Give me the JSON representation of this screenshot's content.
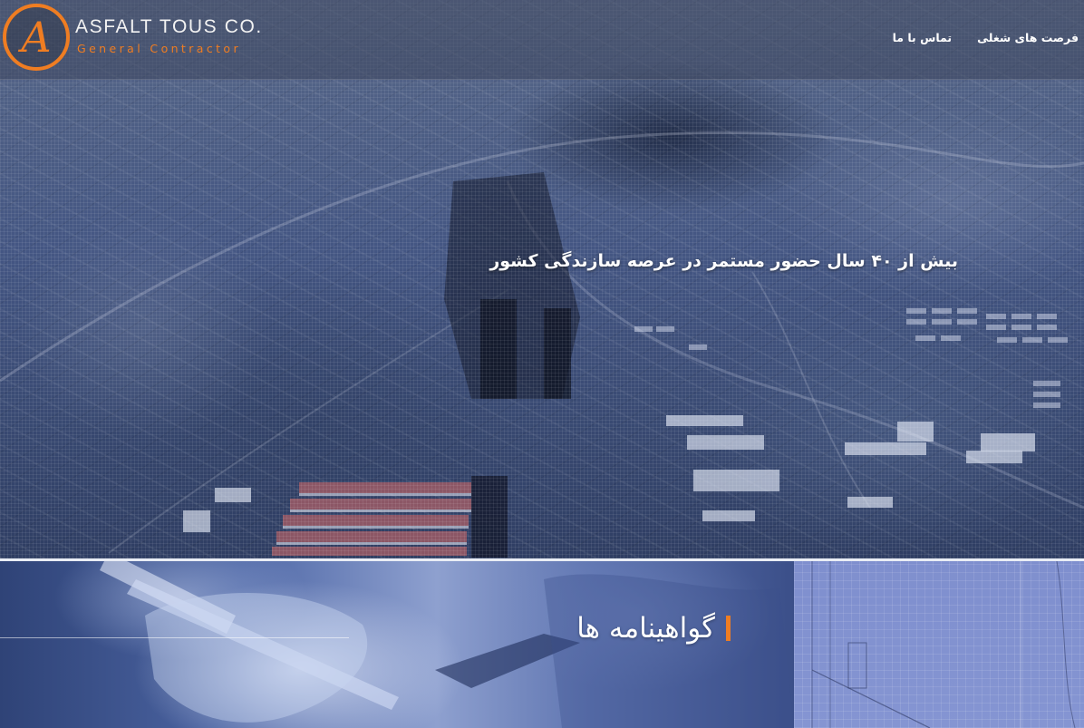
{
  "brand": {
    "name": "ASFALT TOUS CO.",
    "tagline": "General Contractor",
    "letter": "A",
    "accent_color": "#ef7d22"
  },
  "nav": {
    "items": [
      {
        "label": "فرصت های شغلی"
      },
      {
        "label": "تماس با ما"
      }
    ]
  },
  "hero": {
    "title": "بیش از ۴۰ سال حضور مستمر در عرصه سازندگی کشور"
  },
  "certificates": {
    "title": "گواهینامه ها"
  }
}
